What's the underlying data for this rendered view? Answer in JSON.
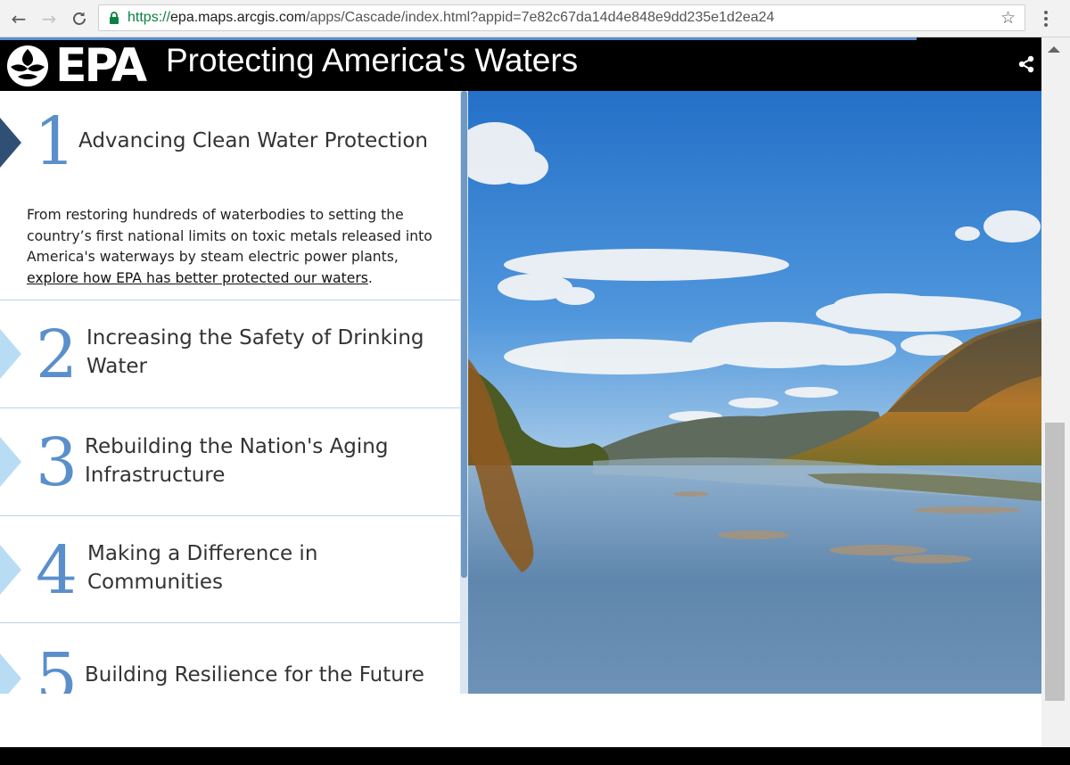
{
  "browser": {
    "back_icon": "arrow-left-icon",
    "forward_icon": "arrow-right-icon",
    "reload_icon": "reload-icon",
    "url_scheme": "https://",
    "url_host": "epa.maps.arcgis.com",
    "url_path": "/apps/Cascade/index.html?appid=7e82c67da14d4e848e9dd235e1d2ea24",
    "bookmark_icon": "star-icon",
    "menu_icon": "kebab-menu-icon"
  },
  "header": {
    "logo_text": "EPA",
    "title": "Protecting America's Waters",
    "share_icon": "share-icon",
    "accent_color": "#5b8fcb"
  },
  "sections": [
    {
      "number": "1",
      "title": "Advancing Clean Water Protection",
      "body": "From restoring hundreds of waterbodies to setting the country’s first national limits on toxic metals released into America's waterways by steam electric power plants,",
      "link": "explore how EPA has better protected our waters",
      "body_end": ".",
      "active": true
    },
    {
      "number": "2",
      "title_line1": "Increasing the Safety of Drinking",
      "title_line2": "Water"
    },
    {
      "number": "3",
      "title_line1": "Rebuilding the Nation's Aging",
      "title_line2": "Infrastructure"
    },
    {
      "number": "4",
      "title_line1": "Making a Difference in",
      "title_line2": "Communities"
    },
    {
      "number": "5",
      "title": "Building Resilience for the Future"
    }
  ],
  "image": {
    "subject": "river-landscape-photo"
  }
}
